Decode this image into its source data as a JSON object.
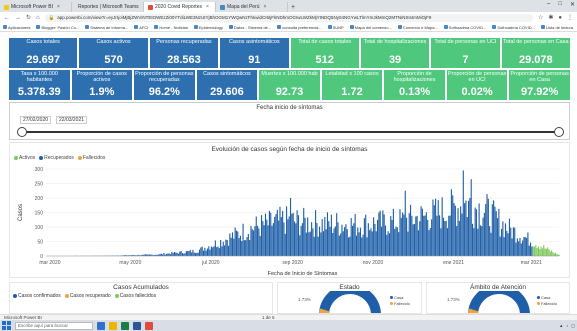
{
  "browser": {
    "tabs": [
      {
        "label": "Microsoft Power BI",
        "color": "#f2c811",
        "active": false
      },
      {
        "label": "Reportes | Microsoft Teams",
        "color": "#5b5fc7",
        "active": false
      },
      {
        "label": "2020 Covid Reportes",
        "color": "#e04b3c",
        "active": true
      },
      {
        "label": "Mapa del Perú",
        "color": "#4a86c5",
        "active": false
      }
    ],
    "new_tab": "+",
    "url": "app.powerbi.com/view?r=eyJrIjoiMjBjZWViNTEtOWEzZi00YTdiLWE3NzUtYjBhOGM1YWQwNzFhIiwidCI6IjFkNDhmOGIwLWZkMjYtNDQ5Ny04NGYwLTlmYmJkMmQ2MTNiNSIsImMiOjF9",
    "bookmarks": [
      "Aplicaciones",
      "Blogger: Pasión Co...",
      "Sistema de Informa...",
      "AFCI",
      "Home - Noticias",
      "Epidemiology",
      "Datos - Sistema de...",
      "consulta preferencia...",
      "SUNP",
      "Mapa del comercio...",
      "Comercio e Mapa...",
      "Sofhoadma COVID...",
      "Sofhoadma COVID...",
      "Lista de lectura"
    ]
  },
  "kpis_row1": [
    {
      "label": "Casos totales",
      "value": "29.697",
      "color": "blue"
    },
    {
      "label": "Casos activos",
      "value": "570",
      "color": "blue"
    },
    {
      "label": "Personas recuperadas",
      "value": "28.563",
      "color": "blue"
    },
    {
      "label": "Casos asintomáticos",
      "value": "91",
      "color": "blue"
    },
    {
      "label": "Total de casos totales",
      "value": "512",
      "color": "green"
    },
    {
      "label": "Total de hospitalizaciones",
      "value": "39",
      "color": "green"
    },
    {
      "label": "Total de personas en UCI",
      "value": "7",
      "color": "green"
    },
    {
      "label": "Total de personas en Casa",
      "value": "29.078",
      "color": "green"
    }
  ],
  "kpis_row2": [
    {
      "label": "Tasa x 100.000 habitantes",
      "value": "5.378.39",
      "color": "blue"
    },
    {
      "label": "Proporción de casos activos",
      "value": "1.9%",
      "color": "blue"
    },
    {
      "label": "Proporción de personas recuperadas",
      "value": "96.2%",
      "color": "blue"
    },
    {
      "label": "Casos sintomáticos",
      "value": "29.606",
      "color": "blue"
    },
    {
      "label": "Muertes x 100.000 hab",
      "value": "92.73",
      "color": "green"
    },
    {
      "label": "Letalidad x 100 casos",
      "value": "1.72",
      "color": "green"
    },
    {
      "label": "Proporción de hospitalizaciones",
      "value": "0.13%",
      "color": "green"
    },
    {
      "label": "Proporción de personas en UCI",
      "value": "0.02%",
      "color": "green"
    },
    {
      "label": "Proporción de personas en Casa",
      "value": "97.92%",
      "color": "green"
    }
  ],
  "colors": {
    "blue": "#2e6fb0",
    "green": "#4fc77d",
    "active": "#7dc95e",
    "recuperados": "#1f5fa8",
    "fallecidos": "#f2a33a"
  },
  "slicer": {
    "title": "Fecha inicio de síntomas",
    "start_date": "27/02/2020",
    "end_date": "22/03/2021",
    "range_start_fraction": 0,
    "range_end_fraction": 1
  },
  "chart": {
    "title": "Evolución de casos según fecha de inicio de síntomas",
    "legend": [
      {
        "name": "Activos",
        "color": "#7dc95e"
      },
      {
        "name": "Recuperados",
        "color": "#1f5fa8"
      },
      {
        "name": "Fallecidos",
        "color": "#f2a33a"
      }
    ]
  },
  "chart_data": {
    "type": "bar",
    "xlabel": "Fecha de Inicio de Síntomas",
    "ylabel": "Casos",
    "ylim": [
      0,
      300
    ],
    "yticks": [
      0,
      50,
      100,
      150,
      200,
      250,
      300
    ],
    "x_range": [
      "2020-02-27",
      "2021-03-22"
    ],
    "xticks": [
      "mar 2020",
      "may 2020",
      "jul 2020",
      "sep 2020",
      "nov 2020",
      "ene 2021",
      "mar 2021"
    ],
    "series_profile": {
      "name": "Recuperados",
      "keypoints": [
        {
          "date": "2020-02-27",
          "value": 0
        },
        {
          "date": "2020-04-15",
          "value": 1
        },
        {
          "date": "2020-05-20",
          "value": 5
        },
        {
          "date": "2020-06-20",
          "value": 18
        },
        {
          "date": "2020-07-10",
          "value": 55
        },
        {
          "date": "2020-08-01",
          "value": 100
        },
        {
          "date": "2020-08-25",
          "value": 125
        },
        {
          "date": "2020-09-20",
          "value": 115
        },
        {
          "date": "2020-10-20",
          "value": 110
        },
        {
          "date": "2020-11-20",
          "value": 120
        },
        {
          "date": "2020-12-20",
          "value": 150
        },
        {
          "date": "2021-01-10",
          "value": 185
        },
        {
          "date": "2021-01-25",
          "value": 160
        },
        {
          "date": "2021-02-10",
          "value": 100
        },
        {
          "date": "2021-02-28",
          "value": 55
        },
        {
          "date": "2021-03-12",
          "value": 25
        },
        {
          "date": "2021-03-22",
          "value": 3
        }
      ],
      "peaks": [
        {
          "date": "2020-08-30",
          "value": 200
        },
        {
          "date": "2020-11-25",
          "value": 225
        },
        {
          "date": "2021-01-08",
          "value": 295
        },
        {
          "date": "2021-01-14",
          "value": 265
        }
      ]
    },
    "activos_from": "2021-03-02"
  },
  "bottom": {
    "acumulados": {
      "title": "Casos Acumulados",
      "legend": [
        {
          "name": "Casos confirmados",
          "color": "#1f5fa8"
        },
        {
          "name": "Casos recuperado",
          "color": "#f2a33a"
        },
        {
          "name": "Casos fallecidos",
          "color": "#7dc95e"
        }
      ]
    },
    "estado": {
      "title": "Estado",
      "pct": "1.73%",
      "legend": [
        "Casa",
        "Fallecido"
      ]
    },
    "ambito": {
      "title": "Ámbito de Atención",
      "pct": "1.73%",
      "legend": [
        "Casa",
        "Fallecido"
      ]
    }
  },
  "statusbar": {
    "app": "Microsoft Power BI",
    "page": "1 de 5"
  },
  "taskbar": {
    "search_placeholder": "Escribe aquí para buscar"
  }
}
